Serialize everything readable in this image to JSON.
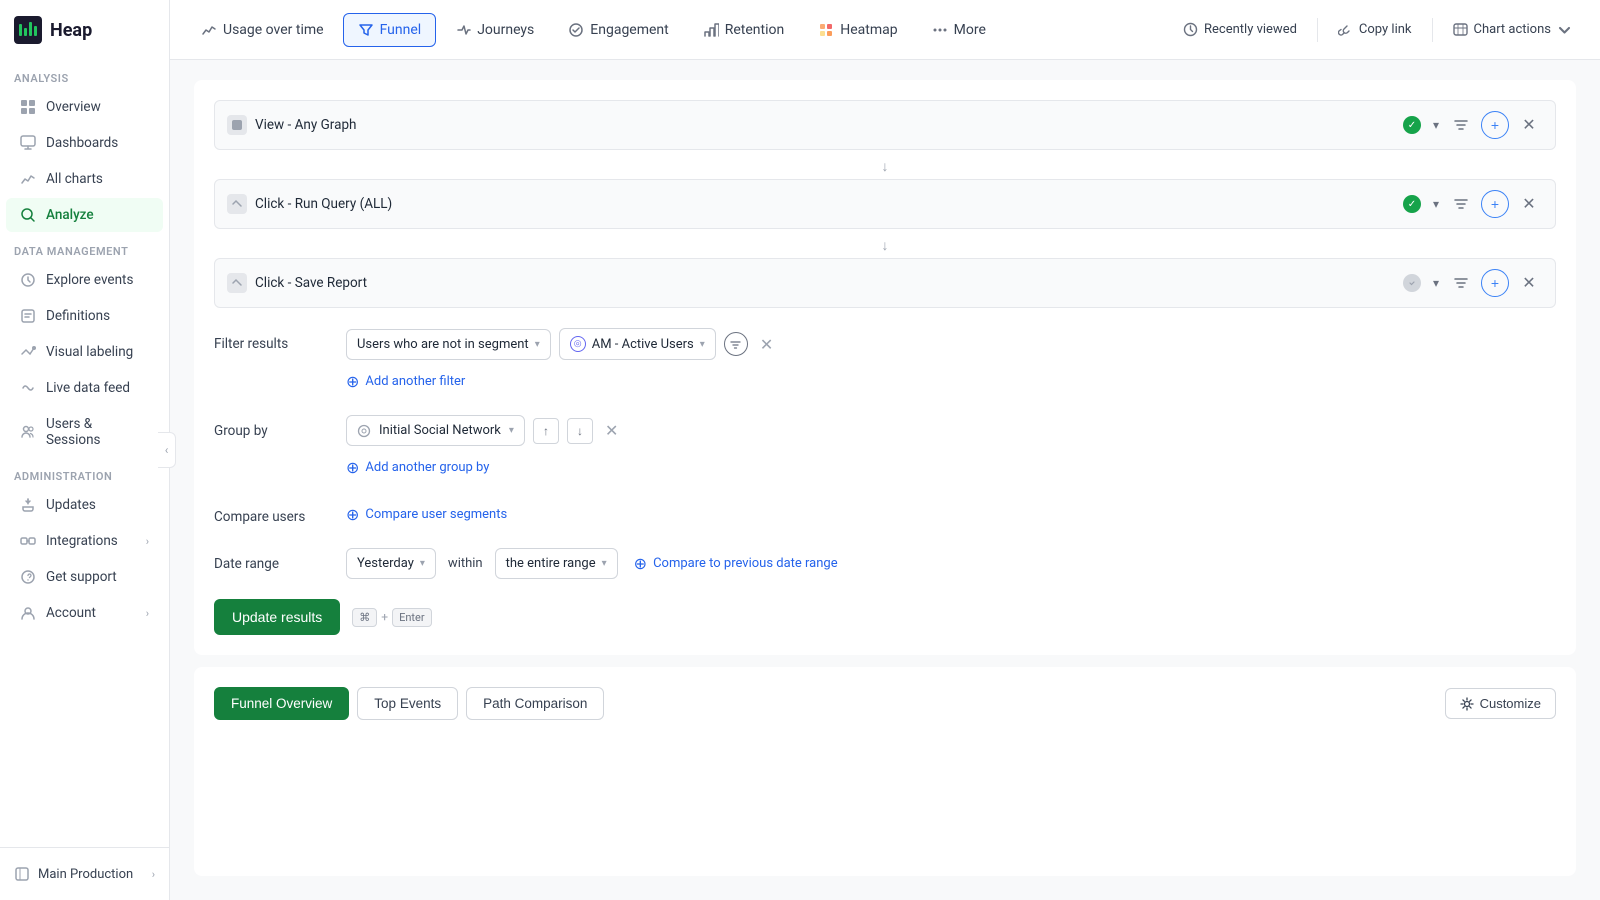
{
  "app": {
    "logo": "Heap"
  },
  "sidebar": {
    "analysis_label": "Analysis",
    "items_analysis": [
      {
        "id": "overview",
        "label": "Overview",
        "active": false
      },
      {
        "id": "dashboards",
        "label": "Dashboards",
        "active": false
      },
      {
        "id": "allcharts",
        "label": "All charts",
        "active": false
      },
      {
        "id": "analyze",
        "label": "Analyze",
        "active": true
      }
    ],
    "data_management_label": "Data Management",
    "items_data": [
      {
        "id": "explore-events",
        "label": "Explore events",
        "active": false
      },
      {
        "id": "definitions",
        "label": "Definitions",
        "active": false
      },
      {
        "id": "visual-labeling",
        "label": "Visual labeling",
        "active": false
      },
      {
        "id": "live-data-feed",
        "label": "Live data feed",
        "active": false
      },
      {
        "id": "users-sessions",
        "label": "Users & Sessions",
        "active": false
      }
    ],
    "administration_label": "Administration",
    "items_admin": [
      {
        "id": "updates",
        "label": "Updates",
        "active": false
      },
      {
        "id": "integrations",
        "label": "Integrations",
        "active": false,
        "arrow": true
      },
      {
        "id": "get-support",
        "label": "Get support",
        "active": false
      },
      {
        "id": "account",
        "label": "Account",
        "active": false,
        "arrow": true
      }
    ],
    "footer": {
      "workspace": "Main Production",
      "arrow": "›"
    }
  },
  "topnav": {
    "tabs": [
      {
        "id": "usage-over-time",
        "label": "Usage over time",
        "active": false
      },
      {
        "id": "funnel",
        "label": "Funnel",
        "active": true
      },
      {
        "id": "journeys",
        "label": "Journeys",
        "active": false
      },
      {
        "id": "engagement",
        "label": "Engagement",
        "active": false
      },
      {
        "id": "retention",
        "label": "Retention",
        "active": false
      },
      {
        "id": "heatmap",
        "label": "Heatmap",
        "active": false
      },
      {
        "id": "more",
        "label": "More",
        "active": false
      }
    ],
    "actions": [
      {
        "id": "recently-viewed",
        "label": "Recently viewed"
      },
      {
        "id": "copy-link",
        "label": "Copy link"
      },
      {
        "id": "chart-actions",
        "label": "Chart actions"
      }
    ]
  },
  "funnel": {
    "steps": [
      {
        "id": "step1",
        "label": "View - Any Graph",
        "has_shield": true
      },
      {
        "id": "step2",
        "label": "Click - Run Query (ALL)",
        "has_shield": true
      },
      {
        "id": "step3",
        "label": "Click - Save Report",
        "has_shield": false
      }
    ],
    "filter": {
      "label": "Filter results",
      "condition": "Users who are not in segment",
      "segment_name": "AM - Active Users",
      "add_filter_label": "Add another filter"
    },
    "group_by": {
      "label": "Group by",
      "value": "Initial Social Network",
      "add_group_label": "Add another group by"
    },
    "compare": {
      "label": "Compare users",
      "add_label": "Compare user segments"
    },
    "date_range": {
      "label": "Date range",
      "value": "Yesterday",
      "within_label": "within",
      "range_value": "the entire range",
      "compare_label": "Compare to previous date range"
    },
    "update_btn": "Update results",
    "shortcut": "⌘ + Enter"
  },
  "results": {
    "tabs": [
      {
        "id": "funnel-overview",
        "label": "Funnel Overview",
        "active": true
      },
      {
        "id": "top-events",
        "label": "Top Events",
        "active": false
      },
      {
        "id": "path-comparison",
        "label": "Path Comparison",
        "active": false
      }
    ],
    "customize_label": "Customize"
  }
}
